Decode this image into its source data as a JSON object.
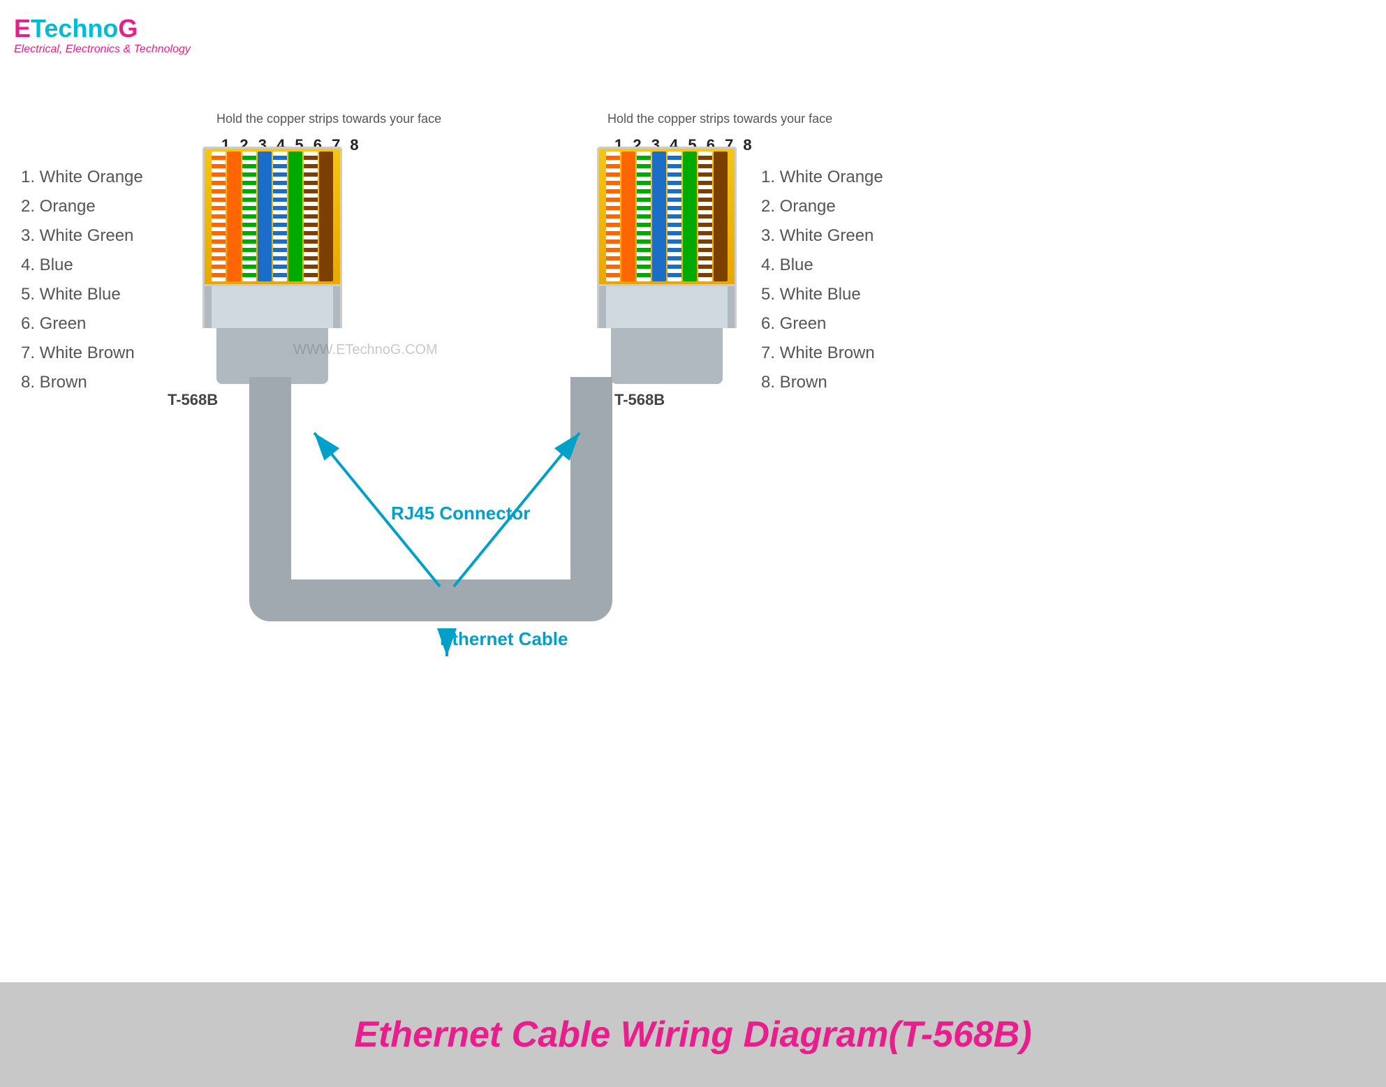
{
  "logo": {
    "prefix": "E",
    "name": "TechnoG",
    "tagline": "Electrical, Electronics & Technology",
    "watermark": "WWW.ETechnoG.COM"
  },
  "header": {
    "instruction": "Hold the copper strips towards your face"
  },
  "wire_numbers": "1 2 3 4 5 6 7 8",
  "left_connector": {
    "label": "T-568B",
    "pins": [
      "1.  White Orange",
      "2.  Orange",
      "3.  White Green",
      "4.  Blue",
      "5.  White Blue",
      "6.  Green",
      "7.  White Brown",
      "8.  Brown"
    ]
  },
  "right_connector": {
    "label": "T-568B",
    "pins": [
      "1.  White Orange",
      "2.  Orange",
      "3.  White Green",
      "4.  Blue",
      "5.  White Blue",
      "6.  Green",
      "7.  White Brown",
      "8.  Brown"
    ]
  },
  "labels": {
    "rj45": "RJ45 Connector",
    "ethernet": "Ethernet Cable"
  },
  "footer": {
    "title": "Ethernet Cable Wiring Diagram(T-568B)"
  }
}
